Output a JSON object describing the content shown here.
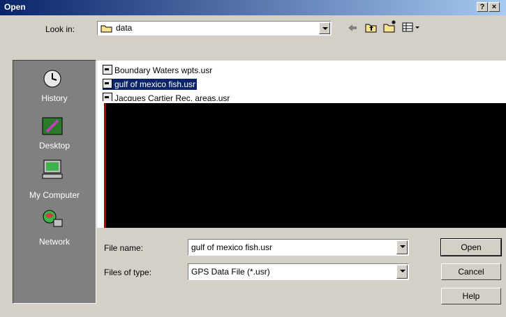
{
  "title": "Open",
  "title_buttons": {
    "help": "?",
    "close": "×"
  },
  "look_in": {
    "label": "Look in:",
    "value": "data"
  },
  "places": [
    {
      "label": "History",
      "icon": "history-icon"
    },
    {
      "label": "Desktop",
      "icon": "desktop-icon"
    },
    {
      "label": "My Computer",
      "icon": "my-computer-icon"
    },
    {
      "label": "Network",
      "icon": "network-icon"
    }
  ],
  "files": [
    {
      "name": "Boundary Waters wpts.usr",
      "selected": false
    },
    {
      "name": "gulf of mexico fish.usr",
      "selected": true
    },
    {
      "name": "Jacques Cartier Rec. areas.usr",
      "selected": false
    }
  ],
  "file_name": {
    "label": "File name:",
    "value": "gulf of mexico fish.usr"
  },
  "file_type": {
    "label": "Files of type:",
    "value": "GPS Data File (*.usr)"
  },
  "buttons": {
    "open": "Open",
    "cancel": "Cancel",
    "help": "Help"
  },
  "colors": {
    "title_start": "#0a246a",
    "title_end": "#a6caf0",
    "selection": "#0a246a",
    "face": "#d4d0c8"
  }
}
